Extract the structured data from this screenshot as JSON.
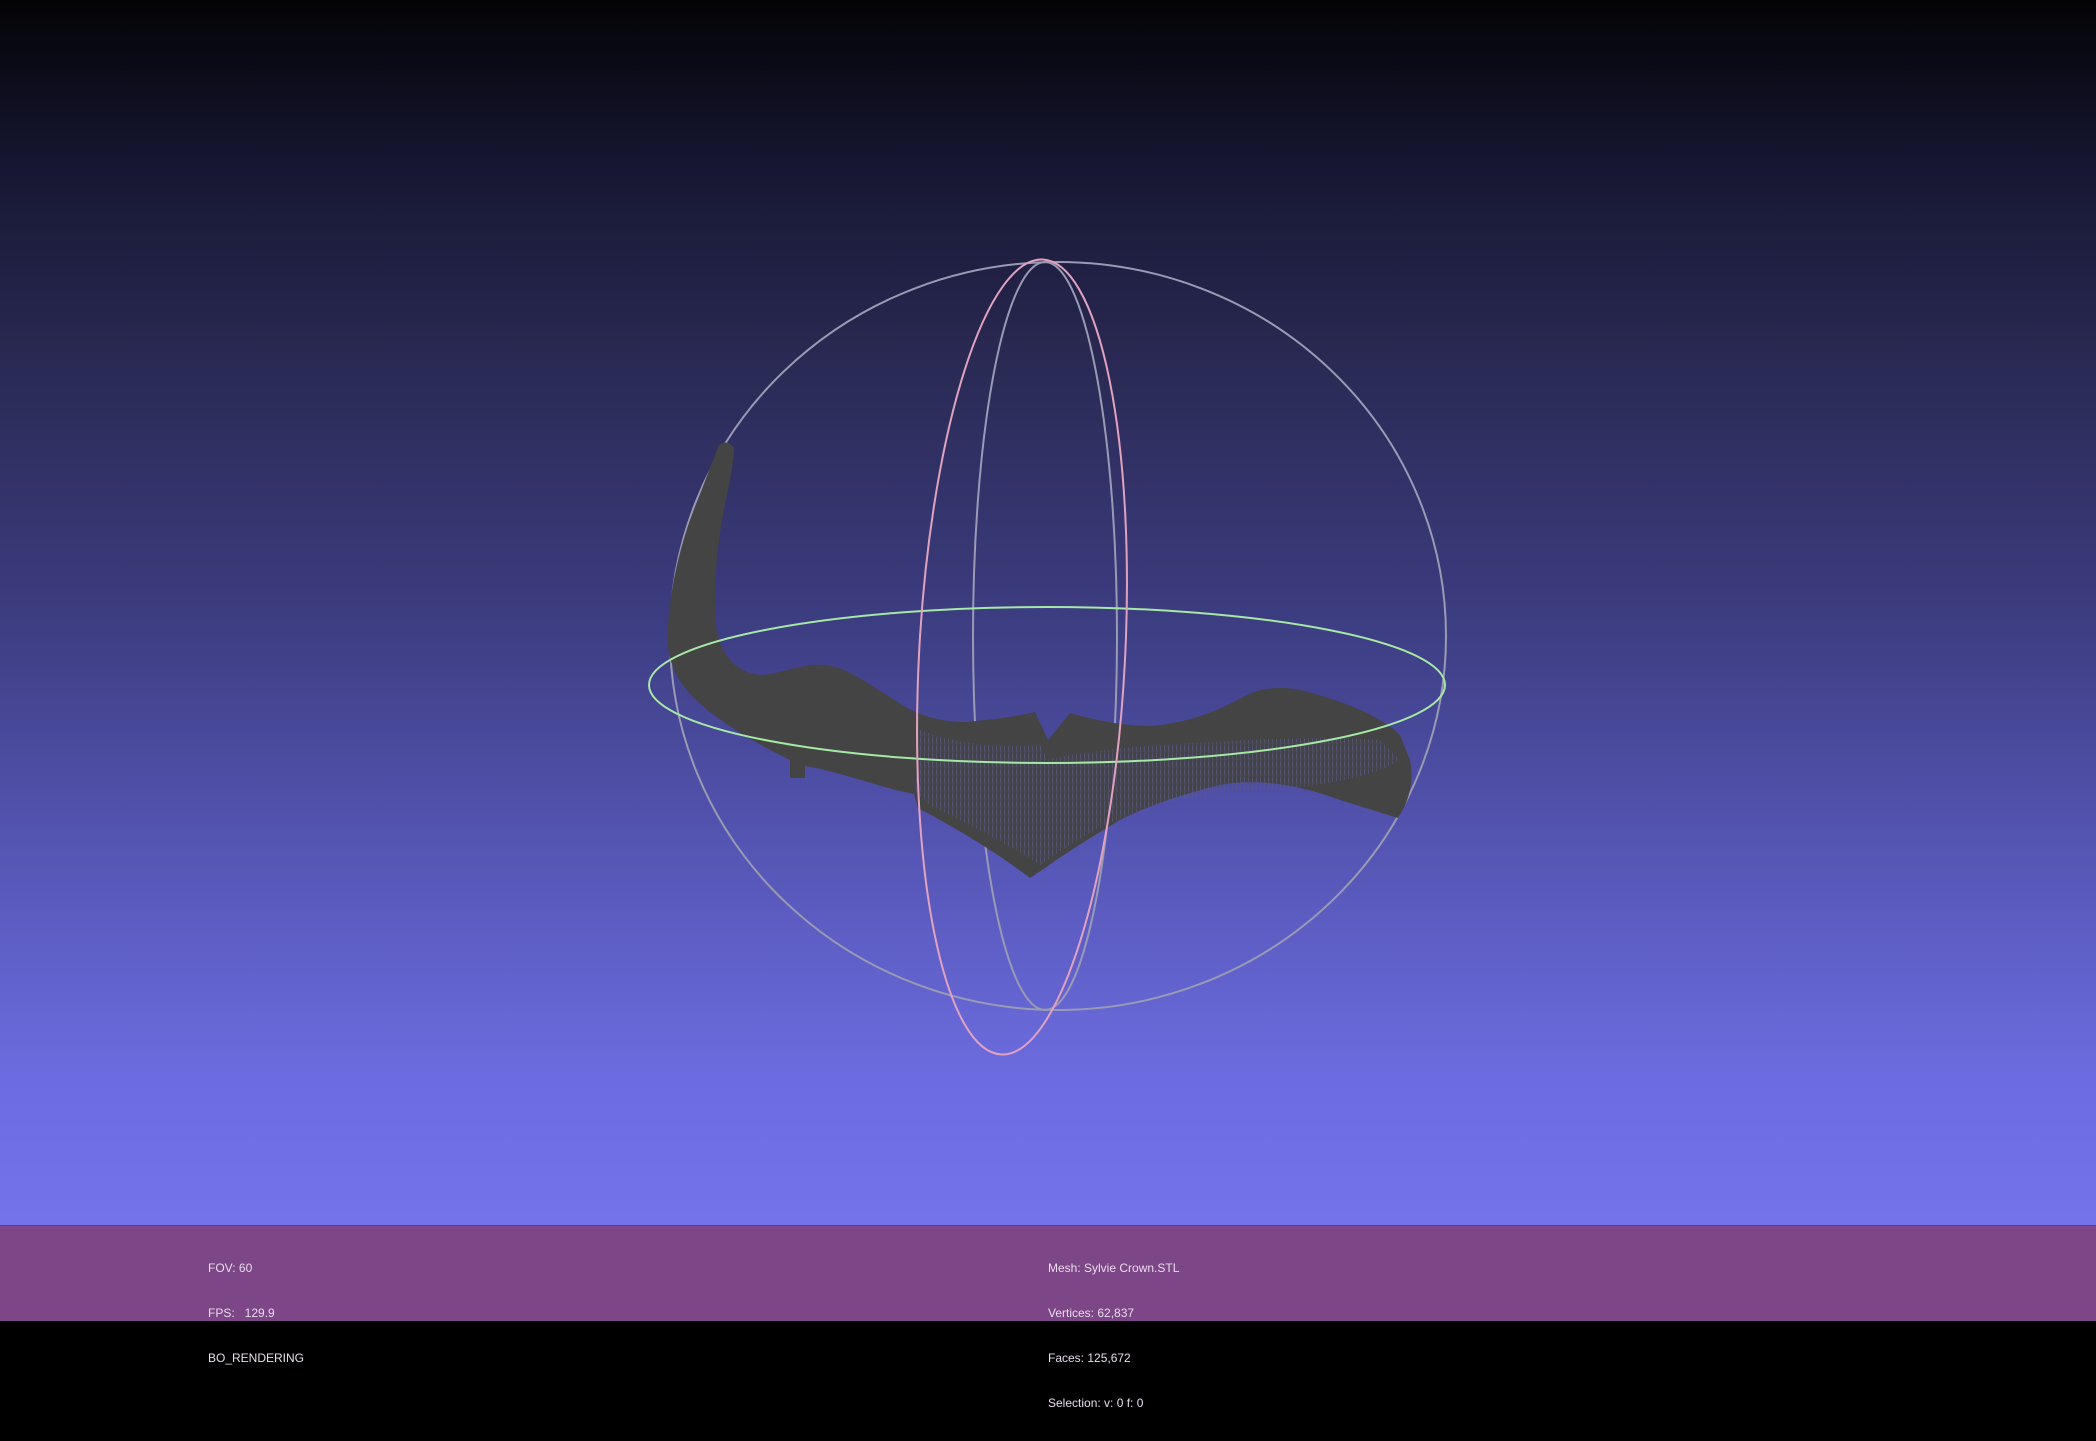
{
  "viewer": {
    "fov_label": "FOV: 60",
    "fps_label": "FPS:   129.9",
    "render_mode": "BO_RENDERING"
  },
  "mesh": {
    "name_label": "Mesh: Sylvie Crown.STL",
    "vertices_label": "Vertices: 62,837",
    "faces_label": "Faces: 125,672",
    "selection_label": "Selection: v: 0 f: 0"
  },
  "trackball": {
    "horizontal_ring_color": "#a6e8a6",
    "vertical_ring_color": "#e0a2be",
    "outer_ring_color": "#9a9ab4"
  },
  "model": {
    "fill_color": "#444444",
    "wire_color": "#5a5a8c"
  }
}
